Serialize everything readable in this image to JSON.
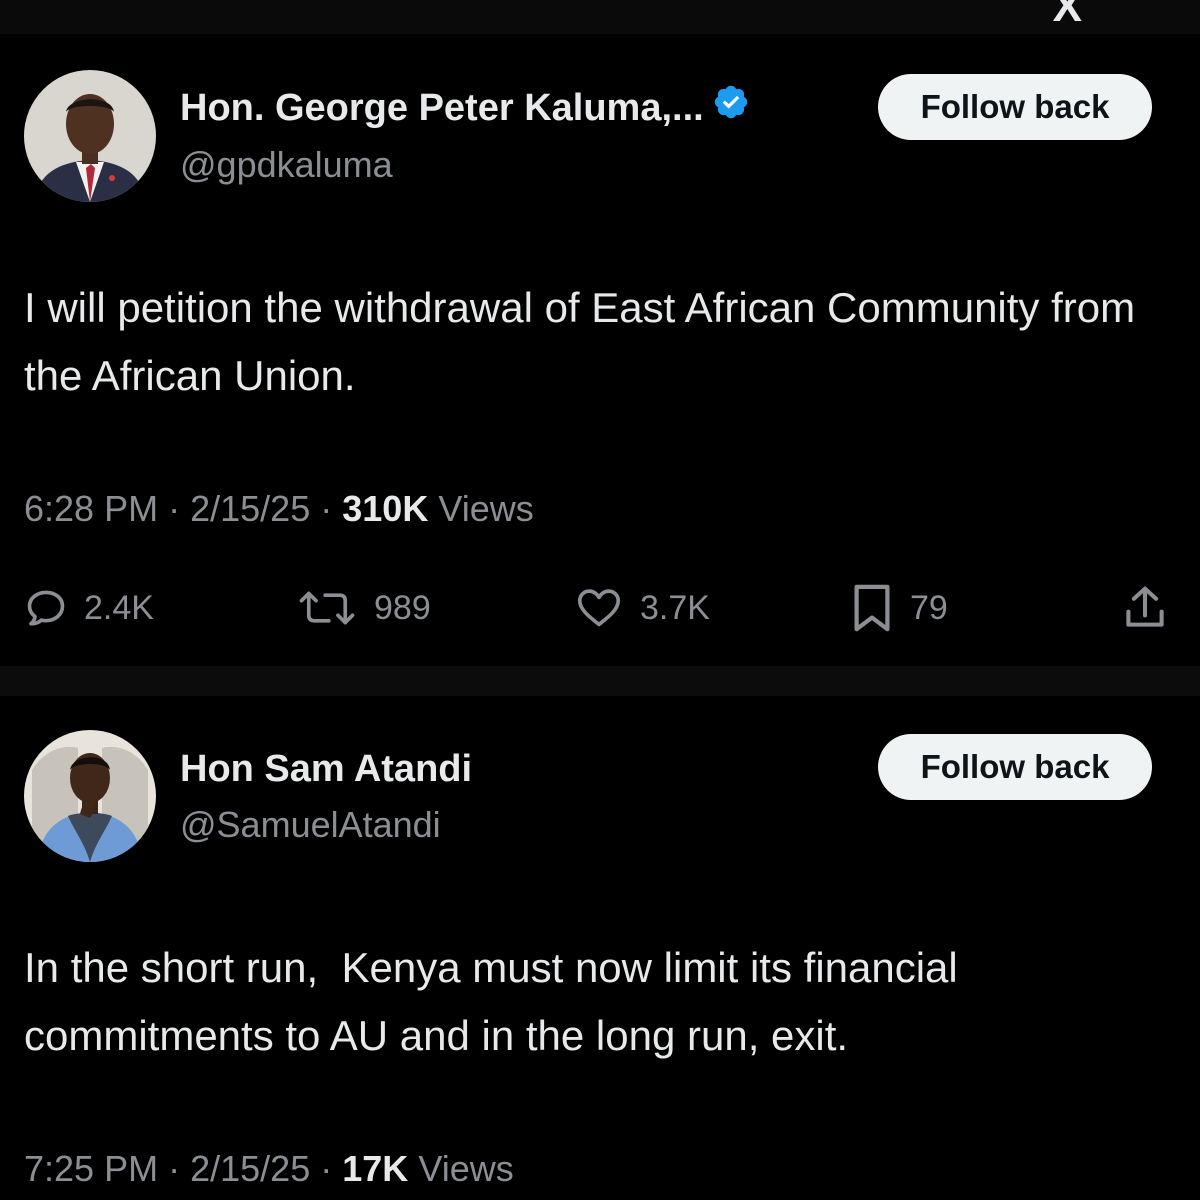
{
  "top_bar": {
    "logo_text": "X"
  },
  "tweets": [
    {
      "display_name": "Hon. George Peter Kaluma,...",
      "handle": "@gpdkaluma",
      "verified": true,
      "follow_label": "Follow back",
      "text": "I will petition the withdrawal of East African Community from the African Union.",
      "time": "6:28 PM",
      "date": "2/15/25",
      "views_count": "310K",
      "views_label": "Views",
      "actions": {
        "replies": "2.4K",
        "reposts": "989",
        "likes": "3.7K",
        "bookmarks": "79"
      }
    },
    {
      "display_name": "Hon Sam Atandi",
      "handle": "@SamuelAtandi",
      "verified": false,
      "follow_label": "Follow back",
      "text": "In the short run,  Kenya must now limit its financial commitments to AU and in the long run, exit.",
      "time": "7:25 PM",
      "date": "2/15/25",
      "views_count": "17K",
      "views_label": "Views"
    }
  ],
  "meta_separator": "·",
  "colors": {
    "background": "#000000",
    "text_primary": "#e7e9ea",
    "text_secondary": "#8b8f94",
    "verified_blue": "#1d9bf0",
    "button_bg": "#eff3f4"
  },
  "icons": {
    "verified": "verified-badge-icon",
    "reply": "reply-icon",
    "repost": "repost-icon",
    "like": "heart-icon",
    "bookmark": "bookmark-icon",
    "share": "share-icon"
  }
}
